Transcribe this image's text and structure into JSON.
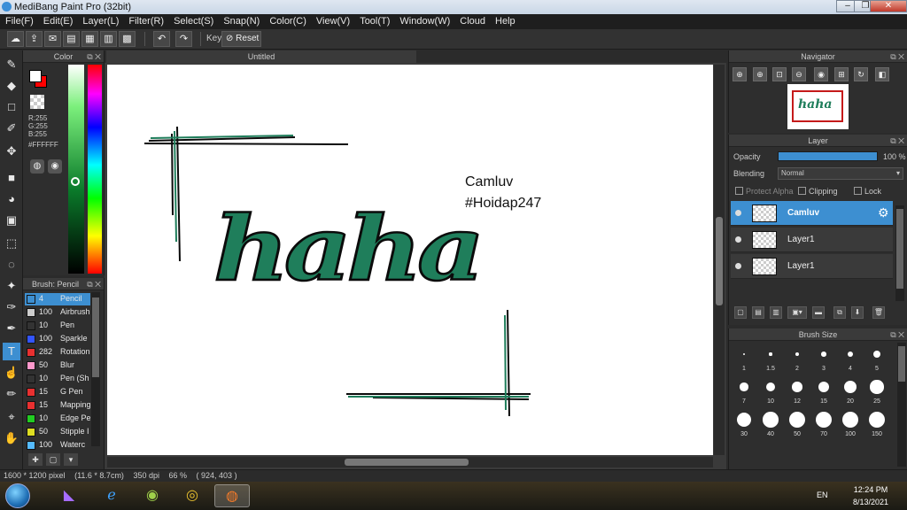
{
  "window": {
    "title": "MediBang Paint Pro (32bit)",
    "controls": [
      "–",
      "❐",
      "✕"
    ]
  },
  "menu": [
    "File(F)",
    "Edit(E)",
    "Layer(L)",
    "Filter(R)",
    "Select(S)",
    "Snap(N)",
    "Color(C)",
    "View(V)",
    "Tool(T)",
    "Window(W)",
    "Cloud",
    "Help"
  ],
  "toolbar": {
    "key_label": "Key",
    "reset_label": "Reset"
  },
  "color_panel": {
    "title": "Color",
    "r": "R:255",
    "g": "G:255",
    "b": "B:255",
    "hex": "#FFFFFF",
    "fg_color": "#FFFFFF",
    "bg_color": "#FF0000"
  },
  "brush_panel": {
    "title": "Brush: Pencil",
    "items": [
      {
        "size": "4",
        "name": "Pencil",
        "color": "#3d8fd1",
        "active": true
      },
      {
        "size": "100",
        "name": "Airbrush",
        "color": "#cccccc"
      },
      {
        "size": "10",
        "name": "Pen",
        "color": "#333333"
      },
      {
        "size": "100",
        "name": "Sparkle",
        "color": "#3355ff"
      },
      {
        "size": "282",
        "name": "Rotation",
        "color": "#e83030"
      },
      {
        "size": "50",
        "name": "Blur",
        "color": "#ff99cc"
      },
      {
        "size": "10",
        "name": "Pen (Sh",
        "color": "#333333"
      },
      {
        "size": "15",
        "name": "G Pen",
        "color": "#e83030"
      },
      {
        "size": "15",
        "name": "Mapping",
        "color": "#e83030"
      },
      {
        "size": "10",
        "name": "Edge Pe",
        "color": "#22cc22"
      },
      {
        "size": "50",
        "name": "Stipple I",
        "color": "#dddd22"
      },
      {
        "size": "100",
        "name": "Waterc",
        "color": "#55bbff"
      }
    ]
  },
  "document": {
    "tab_title": "Untitled",
    "text_line1": "Camluv",
    "text_line2": "#Hoidap247",
    "lettering": "haha",
    "ink_color": "#1f7e5b"
  },
  "status": {
    "size": "1600 * 1200 pixel",
    "cm": "(11.6 * 8.7cm)",
    "dpi": "350 dpi",
    "zoom": "66 %",
    "coords": "( 924, 403 )"
  },
  "navigator": {
    "title": "Navigator"
  },
  "layer_panel": {
    "title": "Layer",
    "opacity_label": "Opacity",
    "opacity_value": "100 %",
    "blending_label": "Blending",
    "blending_value": "Normal",
    "protect_alpha": "Protect Alpha",
    "clipping": "Clipping",
    "lock": "Lock",
    "layers": [
      {
        "name": "Camluv",
        "active": true
      },
      {
        "name": "Layer1"
      },
      {
        "name": "Layer1"
      }
    ]
  },
  "brush_size_panel": {
    "title": "Brush Size",
    "sizes": [
      "1",
      "1.5",
      "2",
      "3",
      "4",
      "5",
      "7",
      "10",
      "12",
      "15",
      "20",
      "25",
      "30",
      "40",
      "50",
      "70",
      "100",
      "150"
    ]
  },
  "taskbar": {
    "lang": "EN",
    "time": "12:24 PM",
    "date": "8/13/2021"
  }
}
